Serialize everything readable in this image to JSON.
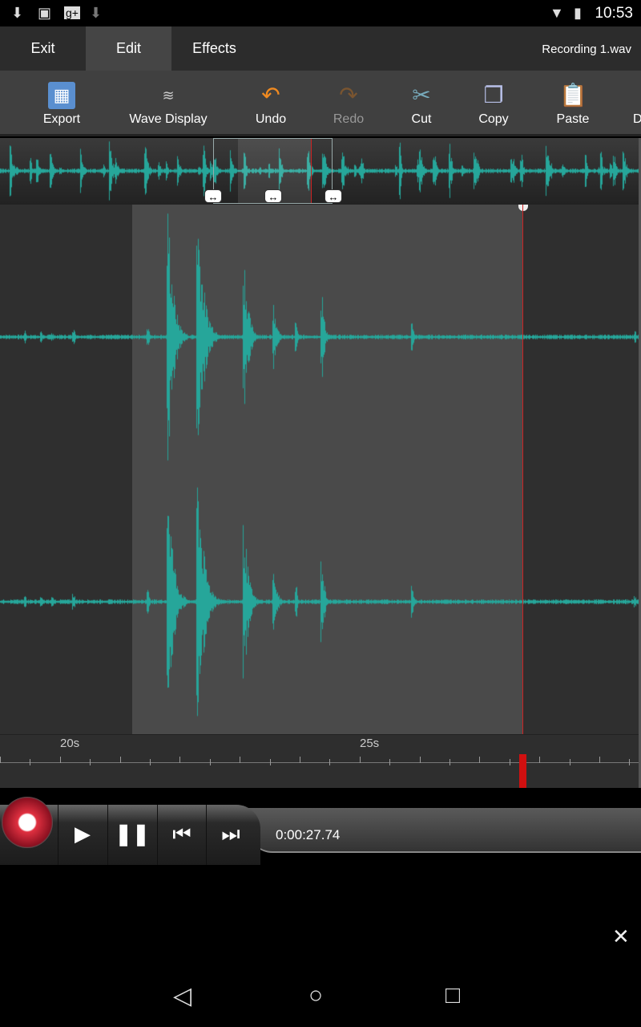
{
  "status": {
    "time": "10:53",
    "icons": [
      "download-icon",
      "image-icon",
      "google-plus-icon",
      "download-icon",
      "wifi-icon",
      "battery-charging-icon"
    ]
  },
  "tabs": [
    {
      "label": "Exit"
    },
    {
      "label": "Edit",
      "selected": true
    },
    {
      "label": "Effects"
    }
  ],
  "file_name": "Recording 1.wav",
  "toolbar": [
    {
      "label": "Export",
      "icon": "export-icon"
    },
    {
      "label": "Wave Display",
      "icon": "wave-display-icon"
    },
    {
      "label": "Undo",
      "icon": "undo-icon"
    },
    {
      "label": "Redo",
      "icon": "redo-icon",
      "disabled": true
    },
    {
      "label": "Cut",
      "icon": "scissors-icon"
    },
    {
      "label": "Copy",
      "icon": "copy-icon"
    },
    {
      "label": "Paste",
      "icon": "paste-icon"
    },
    {
      "label": "D"
    }
  ],
  "ruler": {
    "labels": [
      "20s",
      "25s"
    ]
  },
  "transport": {
    "time": "0:00:27.74"
  },
  "colors": {
    "wave": "#26a69a",
    "cursor": "#cc2222",
    "record": "#e03040"
  }
}
